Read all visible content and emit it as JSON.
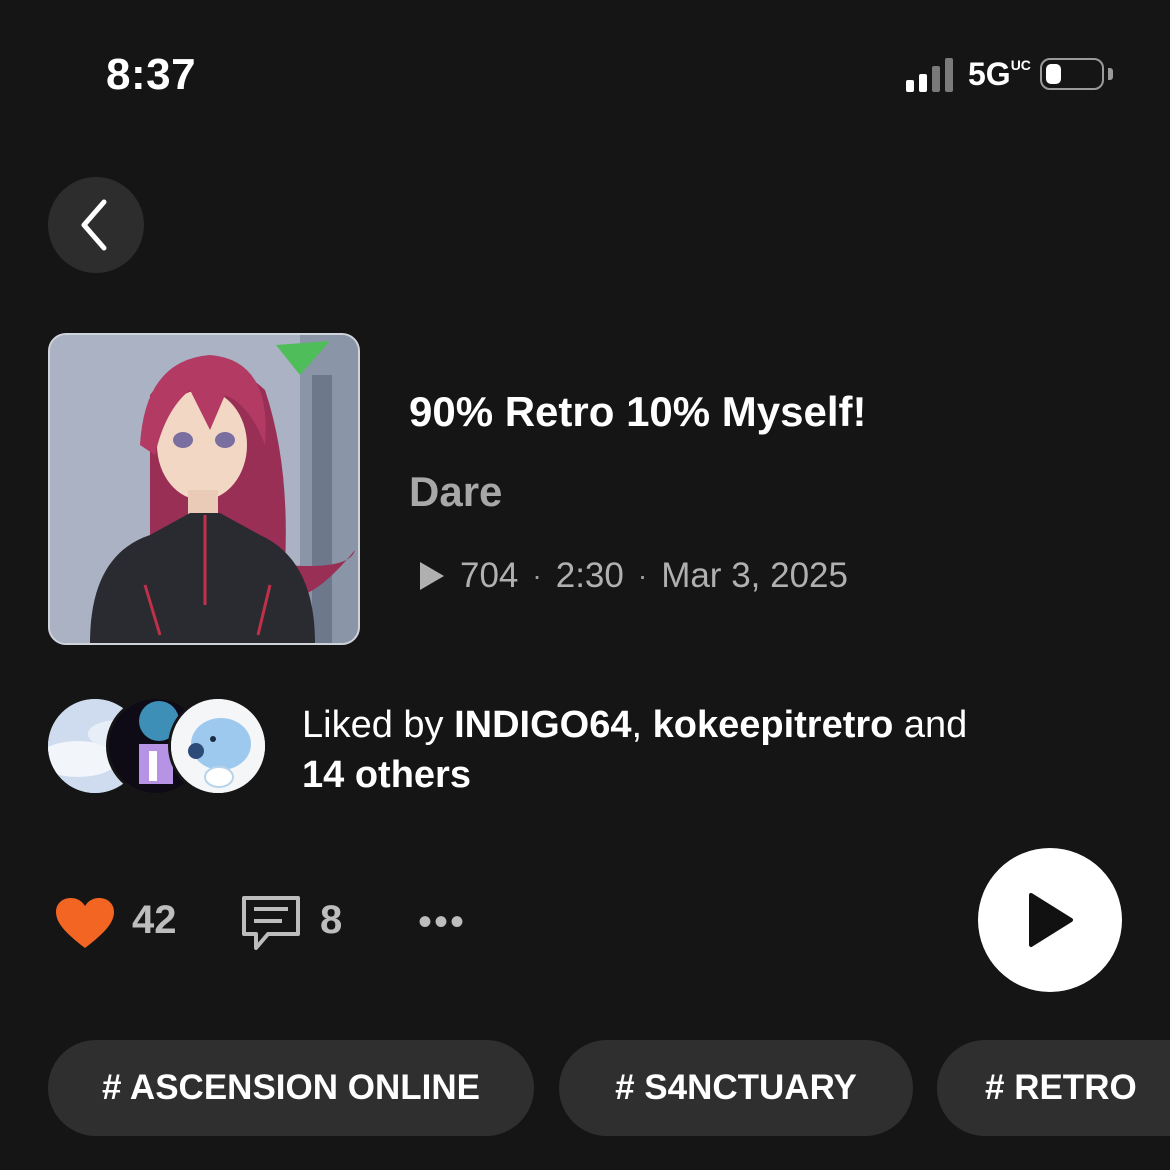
{
  "status_bar": {
    "time": "8:37",
    "network": "5G",
    "network_sup": "UC",
    "battery_level": 0.3
  },
  "track": {
    "title": "90% Retro 10% Myself!",
    "artist": "Dare",
    "plays": "704",
    "duration": "2:30",
    "date": "Mar 3, 2025"
  },
  "likes": {
    "prefix": "Liked by ",
    "user1": "INDIGO64",
    "sep": ", ",
    "user2": "kokeepitretro",
    "and": " and",
    "others": "14 others"
  },
  "actions": {
    "like_count": "42",
    "comment_count": "8",
    "more": "•••"
  },
  "tags": [
    "# ASCENSION ONLINE",
    "# S4NCTUARY",
    "# RETRO"
  ],
  "colors": {
    "background": "#151515",
    "heart": "#f26522",
    "secondary_text": "#a8a8a8"
  }
}
